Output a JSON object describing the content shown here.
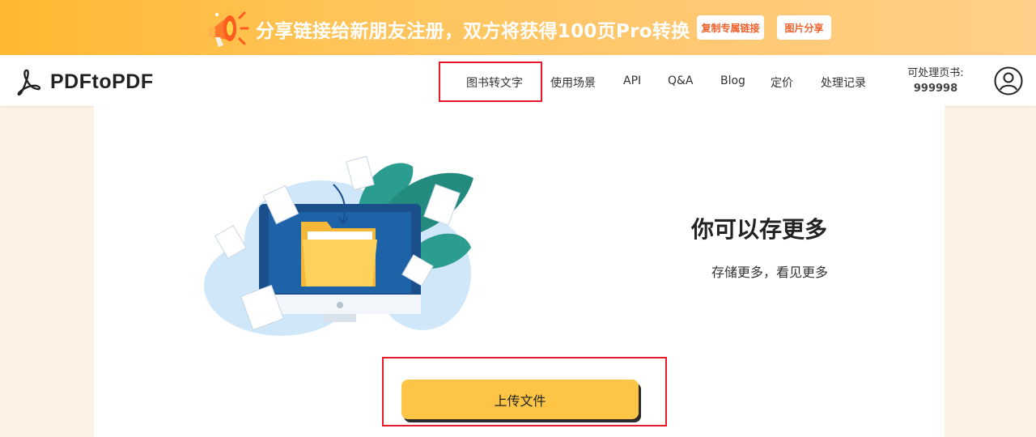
{
  "banner": {
    "text": "分享链接给新朋友注册，双方将获得100页Pro转换",
    "copy_link_label": "复制专属链接",
    "share_image_label": "图片分享",
    "background_color": "#ffb830",
    "button_text_color": "#f0602a"
  },
  "navbar": {
    "logo_text": "PDFtoPDF",
    "items": [
      {
        "label": "图书转文字"
      },
      {
        "label": "使用场景"
      },
      {
        "label": "API"
      },
      {
        "label": "Q&A"
      },
      {
        "label": "Blog"
      },
      {
        "label": "定价"
      },
      {
        "label": "处理记录"
      }
    ],
    "quota_label": "可处理页书:",
    "quota_value": "999998"
  },
  "main": {
    "headline": "你可以存更多",
    "subline": "存储更多，看见更多",
    "upload_label": "上传文件",
    "upload_color": "#fdc445"
  },
  "icons": [
    "megaphone-icon",
    "pdf-logo-icon",
    "user-avatar-icon",
    "folder-icon",
    "document-icon",
    "arrow-down-icon"
  ]
}
